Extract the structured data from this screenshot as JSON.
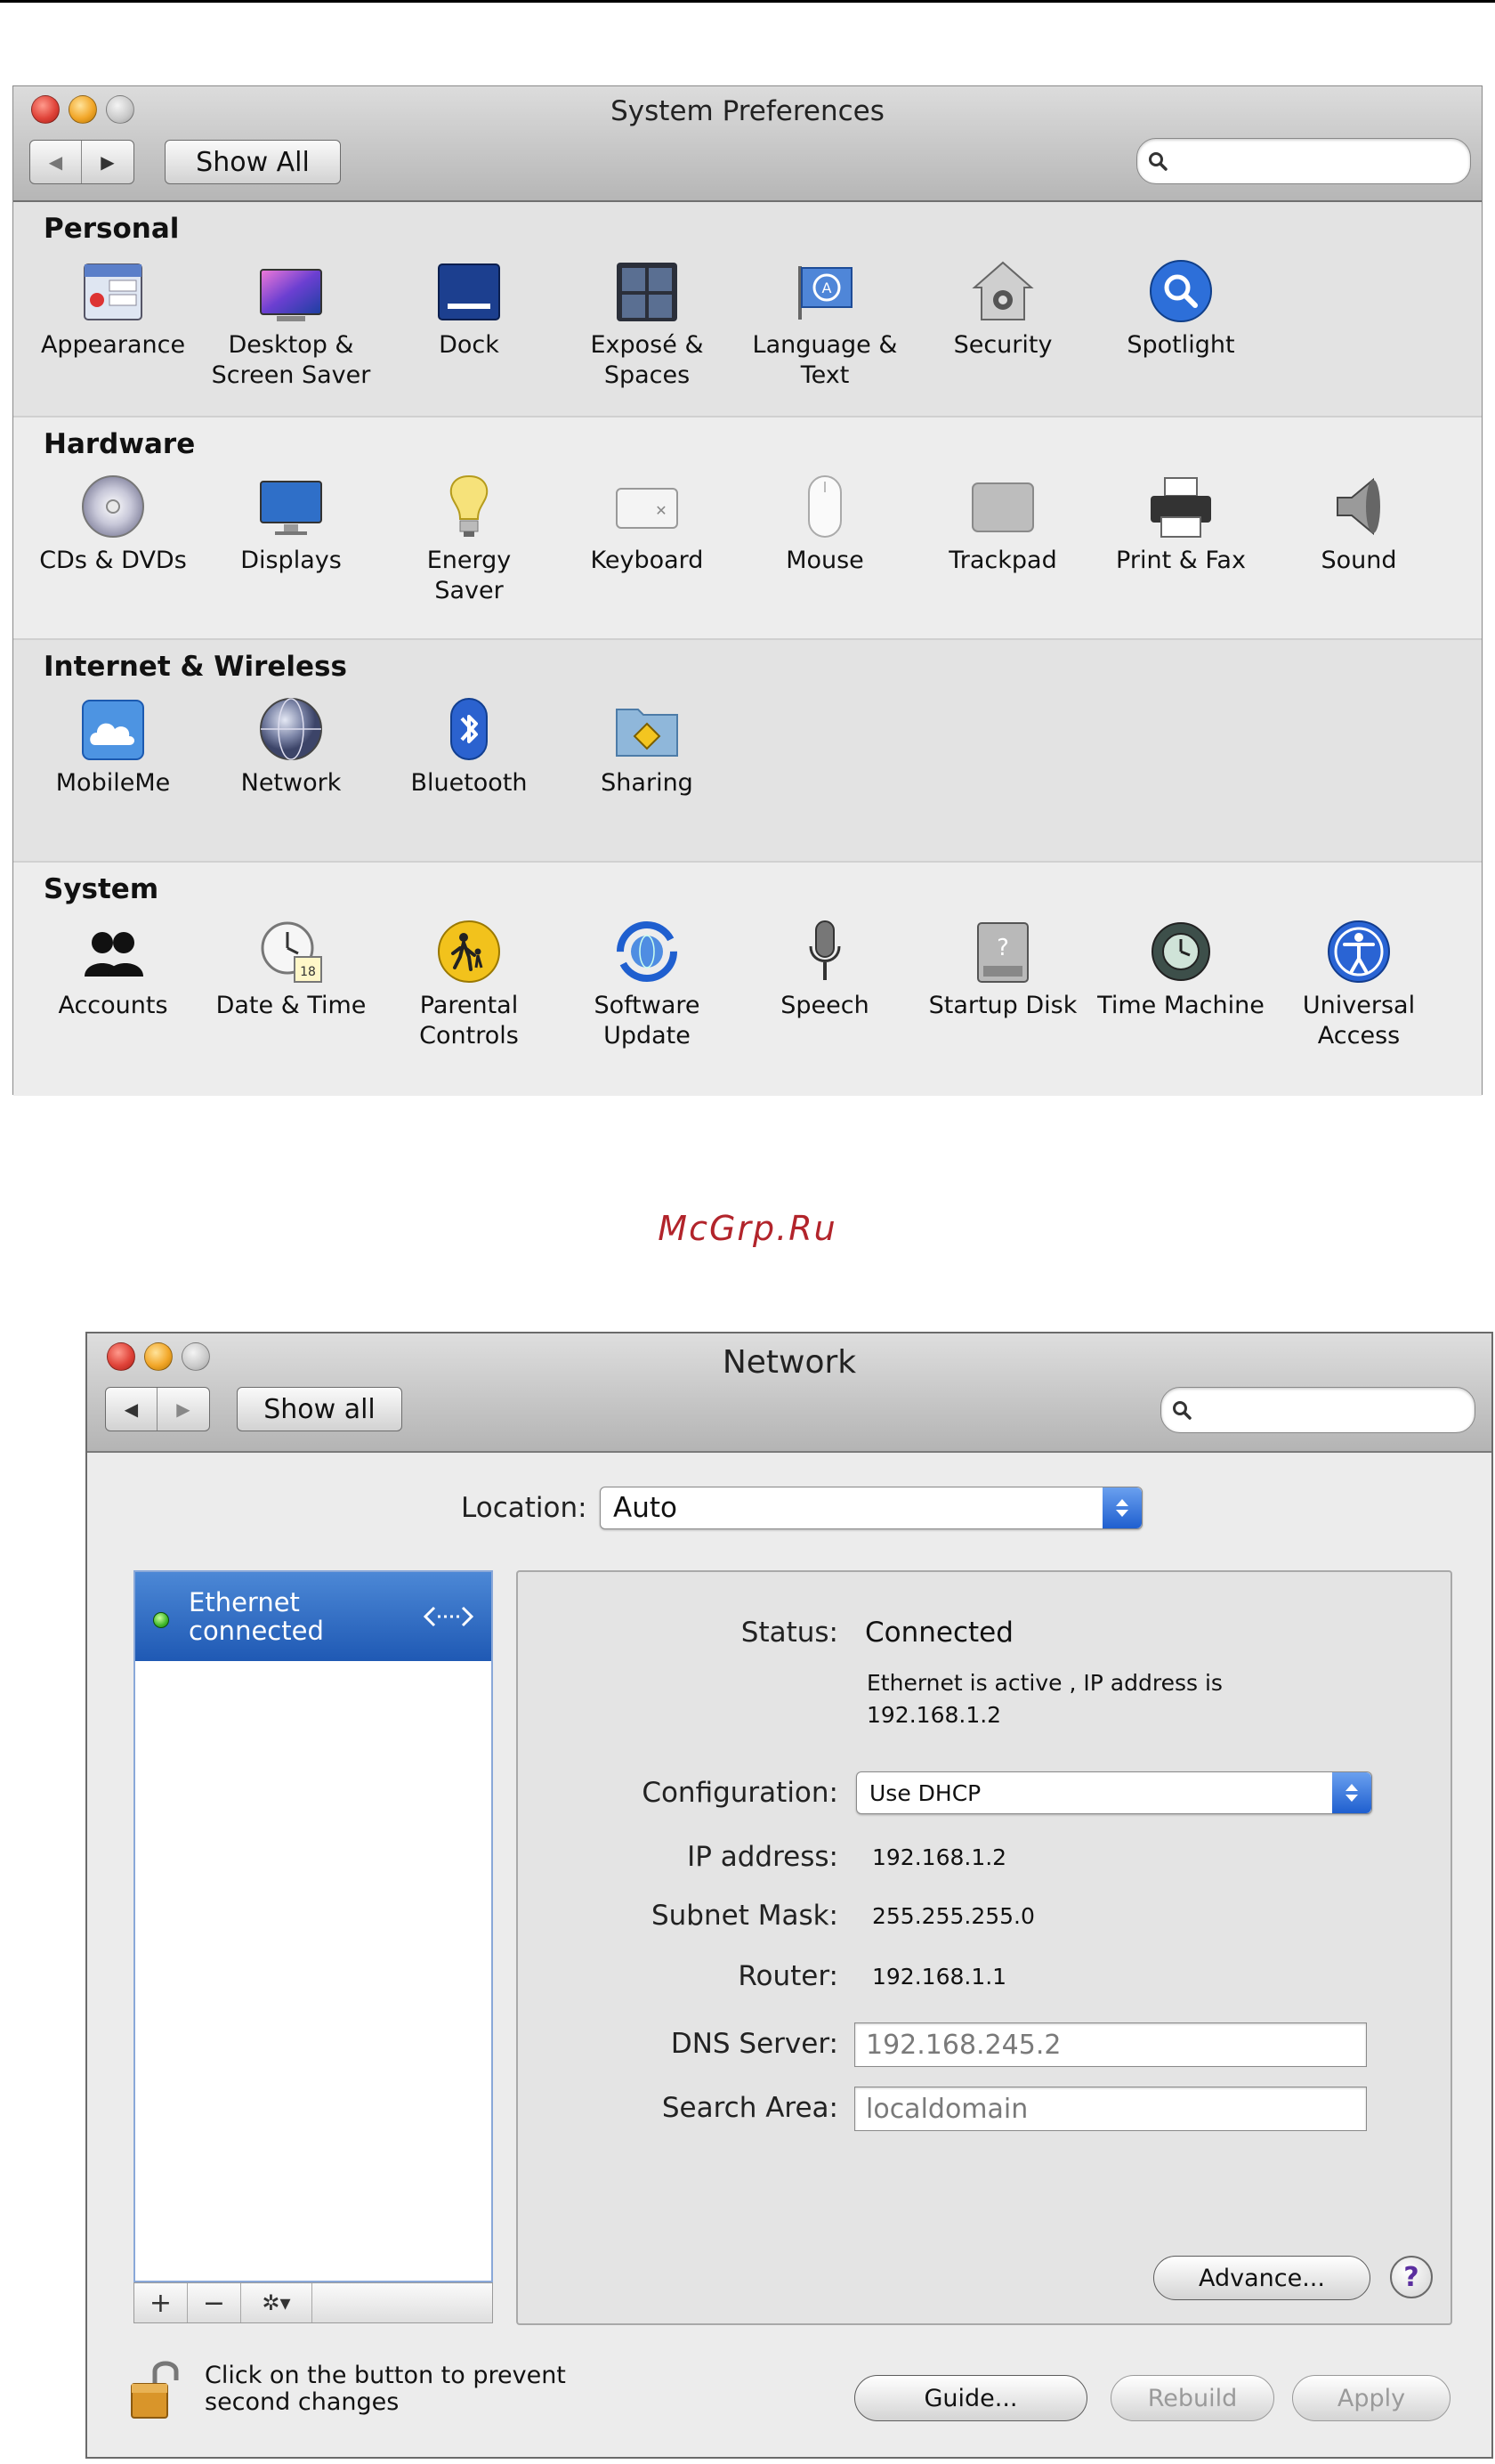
{
  "watermark": "McGrp.Ru",
  "system_preferences": {
    "title": "System Preferences",
    "nav": {
      "back": "◀",
      "forward": "▶"
    },
    "show_all_label": "Show All",
    "search_placeholder": "",
    "sections": [
      {
        "title": "Personal",
        "panes": [
          {
            "label": "Appearance",
            "icon": "appearance-icon"
          },
          {
            "label": "Desktop &\nScreen Saver",
            "icon": "desktop-screensaver-icon"
          },
          {
            "label": "Dock",
            "icon": "dock-icon"
          },
          {
            "label": "Exposé &\nSpaces",
            "icon": "expose-spaces-icon"
          },
          {
            "label": "Language &\nText",
            "icon": "language-text-icon"
          },
          {
            "label": "Security",
            "icon": "security-icon"
          },
          {
            "label": "Spotlight",
            "icon": "spotlight-icon"
          }
        ]
      },
      {
        "title": "Hardware",
        "panes": [
          {
            "label": "CDs & DVDs",
            "icon": "cds-dvds-icon"
          },
          {
            "label": "Displays",
            "icon": "displays-icon"
          },
          {
            "label": "Energy\nSaver",
            "icon": "energy-saver-icon"
          },
          {
            "label": "Keyboard",
            "icon": "keyboard-icon"
          },
          {
            "label": "Mouse",
            "icon": "mouse-icon"
          },
          {
            "label": "Trackpad",
            "icon": "trackpad-icon"
          },
          {
            "label": "Print & Fax",
            "icon": "print-fax-icon"
          },
          {
            "label": "Sound",
            "icon": "sound-icon"
          }
        ]
      },
      {
        "title": "Internet & Wireless",
        "panes": [
          {
            "label": "MobileMe",
            "icon": "mobileme-icon"
          },
          {
            "label": "Network",
            "icon": "network-icon"
          },
          {
            "label": "Bluetooth",
            "icon": "bluetooth-icon"
          },
          {
            "label": "Sharing",
            "icon": "sharing-icon"
          }
        ]
      },
      {
        "title": "System",
        "panes": [
          {
            "label": "Accounts",
            "icon": "accounts-icon"
          },
          {
            "label": "Date & Time",
            "icon": "date-time-icon"
          },
          {
            "label": "Parental\nControls",
            "icon": "parental-controls-icon"
          },
          {
            "label": "Software\nUpdate",
            "icon": "software-update-icon"
          },
          {
            "label": "Speech",
            "icon": "speech-icon"
          },
          {
            "label": "Startup Disk",
            "icon": "startup-disk-icon"
          },
          {
            "label": "Time Machine",
            "icon": "time-machine-icon"
          },
          {
            "label": "Universal\nAccess",
            "icon": "universal-access-icon"
          }
        ]
      }
    ]
  },
  "network": {
    "title": "Network",
    "show_all_label": "Show all",
    "location_label": "Location:",
    "location_value": "Auto",
    "service": {
      "name": "Ethernet",
      "status": "connected"
    },
    "tools": {
      "add": "+",
      "remove": "−",
      "action": "✲▾"
    },
    "status_label": "Status:",
    "status_value": "Connected",
    "status_detail_1": "Ethernet is active , IP address is",
    "status_detail_2": "192.168.1.2",
    "configuration_label": "Configuration:",
    "configuration_value": "Use DHCP",
    "ip_label": "IP address:",
    "ip_value": "192.168.1.2",
    "subnet_label": "Subnet Mask:",
    "subnet_value": "255.255.255.0",
    "router_label": "Router:",
    "router_value": "192.168.1.1",
    "dns_label": "DNS Server:",
    "dns_value": "192.168.245.2",
    "search_label": "Search Area:",
    "search_value": "localdomain",
    "advance_label": "Advance...",
    "help_label": "?",
    "lock_text_1": "Click on the button to prevent",
    "lock_text_2": "second changes",
    "guide_label": "Guide...",
    "rebuild_label": "Rebuild",
    "apply_label": "Apply"
  },
  "colors": {
    "selection": "#2a66c2",
    "watermark": "#b2242b",
    "status_dot": "#3fb82a"
  }
}
